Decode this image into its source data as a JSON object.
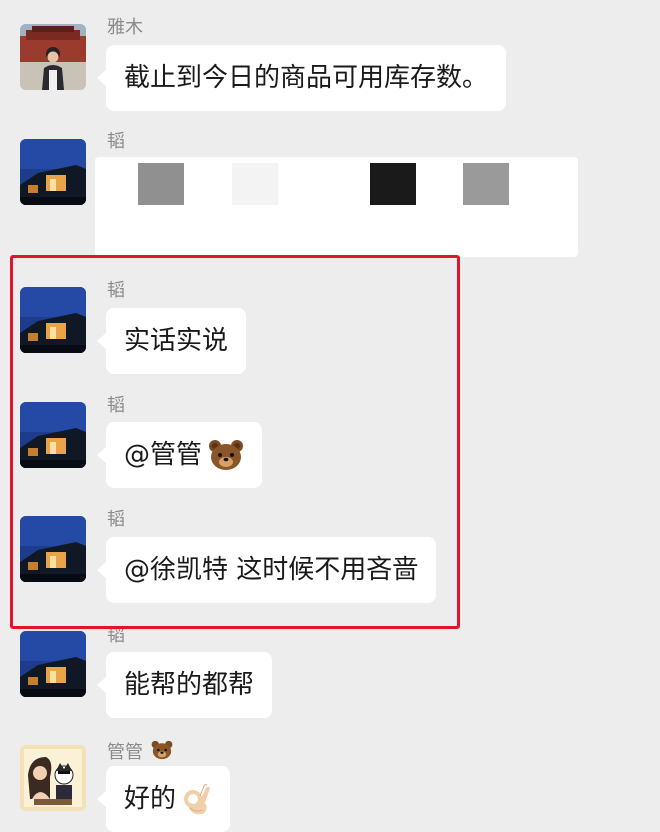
{
  "messages": [
    {
      "sender": "雅木",
      "text": "截止到今日的商品可用库存数。",
      "avatar": "person-photo-avatar"
    },
    {
      "sender": "韬",
      "text": "",
      "redacted": true,
      "avatar": "building-night-avatar"
    },
    {
      "sender": "韬",
      "text": "实话实说",
      "avatar": "building-night-avatar"
    },
    {
      "sender": "韬",
      "text": "@管管",
      "emoji": "bear-face-emoji",
      "avatar": "building-night-avatar"
    },
    {
      "sender": "韬",
      "text": "@徐凯特 这时候不用吝啬",
      "avatar": "building-night-avatar"
    },
    {
      "sender": "韬",
      "text": "能帮的都帮",
      "avatar": "building-night-avatar"
    },
    {
      "sender": "管管",
      "sender_emoji": "bear-face-emoji",
      "text": "好的",
      "emoji": "ok-hand-emoji",
      "avatar": "cartoon-avatar"
    }
  ],
  "colors": {
    "background": "#ededed",
    "bubble": "#ffffff",
    "highlight": "#e0142d",
    "sender_text": "#8a8a8a"
  }
}
